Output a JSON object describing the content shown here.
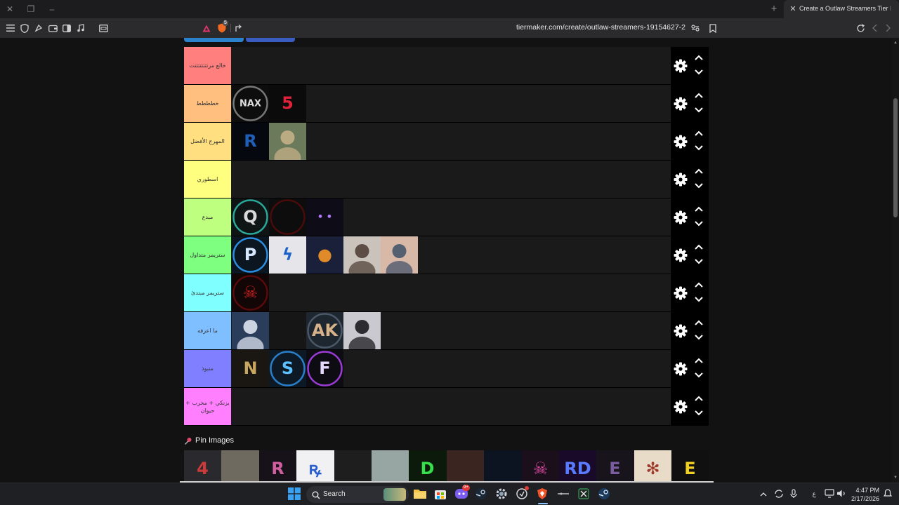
{
  "browser": {
    "tab_title": "Create a Outlaw Streamers Tier L",
    "url": "tiermaker.com/create/outlaw-streamers-19154627-2",
    "shield_badge": "5"
  },
  "tiers": [
    {
      "label": "خالع مرتتتتتتتتت",
      "color": "#ff7f7f",
      "items": []
    },
    {
      "label": "خطططط",
      "color": "#ffbf7f",
      "items": [
        {
          "name": "nax-logo",
          "kind": "ring",
          "bg": "#0d0d0d",
          "ring": "#777777",
          "fg": "#dddddd",
          "text": "NAX"
        },
        {
          "name": "red-five-logo",
          "kind": "flat",
          "bg": "#0b0b0b",
          "fg": "#e0223a",
          "text": "5"
        }
      ]
    },
    {
      "label": "المهرج الأفضل",
      "color": "#ffdf7f",
      "items": [
        {
          "name": "blue-r-logo",
          "kind": "flat",
          "bg": "#05080f",
          "fg": "#1f5fb8",
          "text": "R"
        },
        {
          "name": "soldier-photo",
          "kind": "photo",
          "bg": "#6b7a5a",
          "fg": "#c9b48a",
          "text": ""
        }
      ]
    },
    {
      "label": "اسطوري",
      "color": "#ffff7f",
      "items": []
    },
    {
      "label": "مبدع",
      "color": "#bfff7f",
      "items": [
        {
          "name": "teal-q-logo",
          "kind": "ring",
          "bg": "#0f1414",
          "ring": "#2aa89a",
          "fg": "#d9d9d9",
          "text": "Q"
        },
        {
          "name": "dark-red-ring-avatar",
          "kind": "ring",
          "bg": "#0d0d0d",
          "ring": "#4a0b0b",
          "fg": "#7a1010",
          "text": ""
        },
        {
          "name": "purple-eyes-avatar",
          "kind": "flat",
          "bg": "#0e0c16",
          "fg": "#b37cff",
          "text": "• •"
        }
      ]
    },
    {
      "label": "ستريمر متداول",
      "color": "#7fff7f",
      "items": [
        {
          "name": "blue-pd-logo",
          "kind": "ring",
          "bg": "#0c1620",
          "ring": "#2b8de0",
          "fg": "#d6e8ff",
          "text": "P"
        },
        {
          "name": "blue-lightning-logo",
          "kind": "flat",
          "bg": "#e6e6ea",
          "fg": "#1d63c9",
          "text": "ϟ"
        },
        {
          "name": "anime-pumpkin-avatar",
          "kind": "flat",
          "bg": "#1a1f3a",
          "fg": "#e08a2a",
          "text": "●"
        },
        {
          "name": "bearded-man-photo",
          "kind": "photo",
          "bg": "#c9c3bb",
          "fg": "#4a3a30",
          "text": ""
        },
        {
          "name": "woman-photo",
          "kind": "photo",
          "bg": "#d8b9a8",
          "fg": "#3d4f66",
          "text": ""
        }
      ]
    },
    {
      "label": "ستريمر مبتدئ",
      "color": "#7fffff",
      "items": [
        {
          "name": "red-skull-avatar",
          "kind": "ring",
          "bg": "#120606",
          "ring": "#5a0a0a",
          "fg": "#d02020",
          "text": "☠"
        }
      ]
    },
    {
      "label": "ما اعرفه",
      "color": "#7fbfff",
      "items": [
        {
          "name": "anime-white-hair-avatar",
          "kind": "photo",
          "bg": "#2a3d5a",
          "fg": "#e8eef8",
          "text": ""
        },
        {
          "name": "dark-shadow-avatar",
          "kind": "flat",
          "bg": "#161616",
          "fg": "#3a3a3a",
          "text": ""
        },
        {
          "name": "ak-logo",
          "kind": "ring",
          "bg": "#1e2630",
          "ring": "#4a5868",
          "fg": "#d8b38a",
          "text": "AK"
        },
        {
          "name": "dark-hair-anime-avatar",
          "kind": "photo",
          "bg": "#c9c9cf",
          "fg": "#101014",
          "text": ""
        }
      ]
    },
    {
      "label": "منبوذ",
      "color": "#7f7fff",
      "items": [
        {
          "name": "gold-n-logo",
          "kind": "flat",
          "bg": "#1a1712",
          "fg": "#c9a760",
          "text": "N"
        },
        {
          "name": "blue-s-logo",
          "kind": "ring",
          "bg": "#0d1a26",
          "ring": "#2b7fc9",
          "fg": "#5cc2ff",
          "text": "S"
        },
        {
          "name": "purple-f-logo",
          "kind": "ring",
          "bg": "#0c0c12",
          "ring": "#9b3bd6",
          "fg": "#e5d7ff",
          "text": "F"
        }
      ]
    },
    {
      "label": "بزنكي + مخرب + حيوان",
      "color": "#ff7fff",
      "items": []
    }
  ],
  "pin": {
    "title": "Pin Images",
    "items": [
      {
        "name": "catwoman-pin",
        "bg": "#2a2a2e",
        "fg": "#cc3a3a",
        "text": "4"
      },
      {
        "name": "bird-photo-pin",
        "bg": "#6e6a60",
        "fg": "#dcd4c4",
        "text": ""
      },
      {
        "name": "pink-r-logo-pin",
        "bg": "#17121a",
        "fg": "#d05fa0",
        "text": "R"
      },
      {
        "name": "blue-script-logo-pin",
        "bg": "#f1f1f4",
        "fg": "#2a5fcf",
        "text": "ꝶ"
      },
      {
        "name": "dark-portrait-pin",
        "bg": "#1e1e1e",
        "fg": "#6a6a6a",
        "text": ""
      },
      {
        "name": "yellow-hands-pin",
        "bg": "#97a5a3",
        "fg": "#e6c24a",
        "text": ""
      },
      {
        "name": "green-d-logo-pin",
        "bg": "#0b1a0b",
        "fg": "#35e04a",
        "text": "D"
      },
      {
        "name": "woman-portrait-pin",
        "bg": "#3a2520",
        "fg": "#b08070",
        "text": ""
      },
      {
        "name": "blue-lion-pin",
        "bg": "#0b1420",
        "fg": "#6a8db0",
        "text": ""
      },
      {
        "name": "pink-skull-pin",
        "bg": "#1a0f1a",
        "fg": "#e04aa6",
        "text": "☠"
      },
      {
        "name": "rd-logo-pin",
        "bg": "#1a0a2a",
        "fg": "#5a7bff",
        "text": "RD"
      },
      {
        "name": "purple-e-logo-pin",
        "bg": "#17141c",
        "fg": "#7a5ca0",
        "text": "E"
      },
      {
        "name": "ornate-seal-pin",
        "bg": "#e8dcc8",
        "fg": "#a03a2a",
        "text": "✻"
      },
      {
        "name": "yellow-e-logo-pin",
        "bg": "#101010",
        "fg": "#f0d020",
        "text": "E"
      }
    ]
  },
  "taskbar": {
    "search_label": "Search",
    "time": "4:47 PM",
    "date": "2/17/2026",
    "lang": "ع",
    "discord_badge": "9+"
  }
}
